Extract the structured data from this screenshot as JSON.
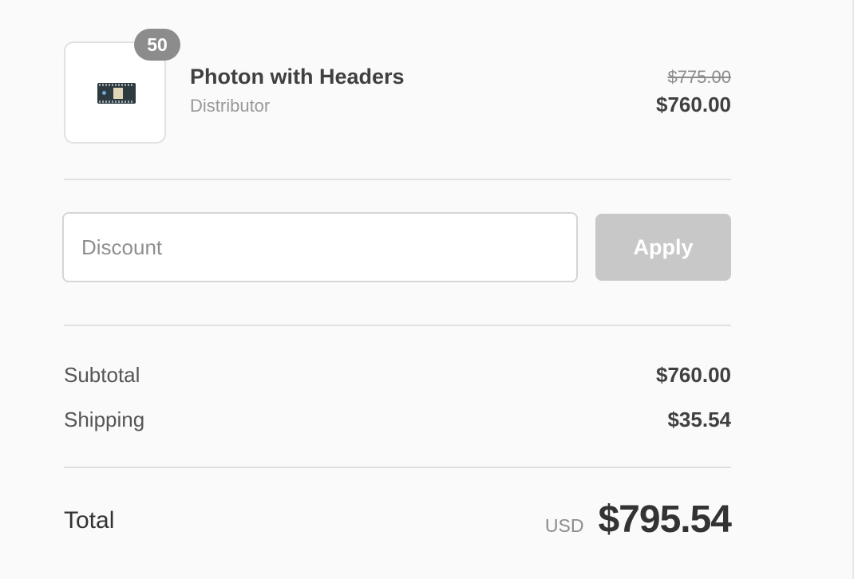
{
  "line_item": {
    "quantity": "50",
    "name": "Photon with Headers",
    "variant": "Distributor",
    "original_price": "$775.00",
    "price": "$760.00",
    "image_icon": "photon-board-icon"
  },
  "discount": {
    "placeholder": "Discount",
    "value": "",
    "apply_label": "Apply"
  },
  "totals": {
    "subtotal_label": "Subtotal",
    "subtotal_value": "$760.00",
    "shipping_label": "Shipping",
    "shipping_value": "$35.54",
    "total_label": "Total",
    "currency": "USD",
    "total_value": "$795.54"
  },
  "colors": {
    "background": "#fafafa",
    "badge": "#8c8c8c",
    "apply_button_disabled": "#c8c8c8",
    "divider": "#e1e1e1"
  }
}
